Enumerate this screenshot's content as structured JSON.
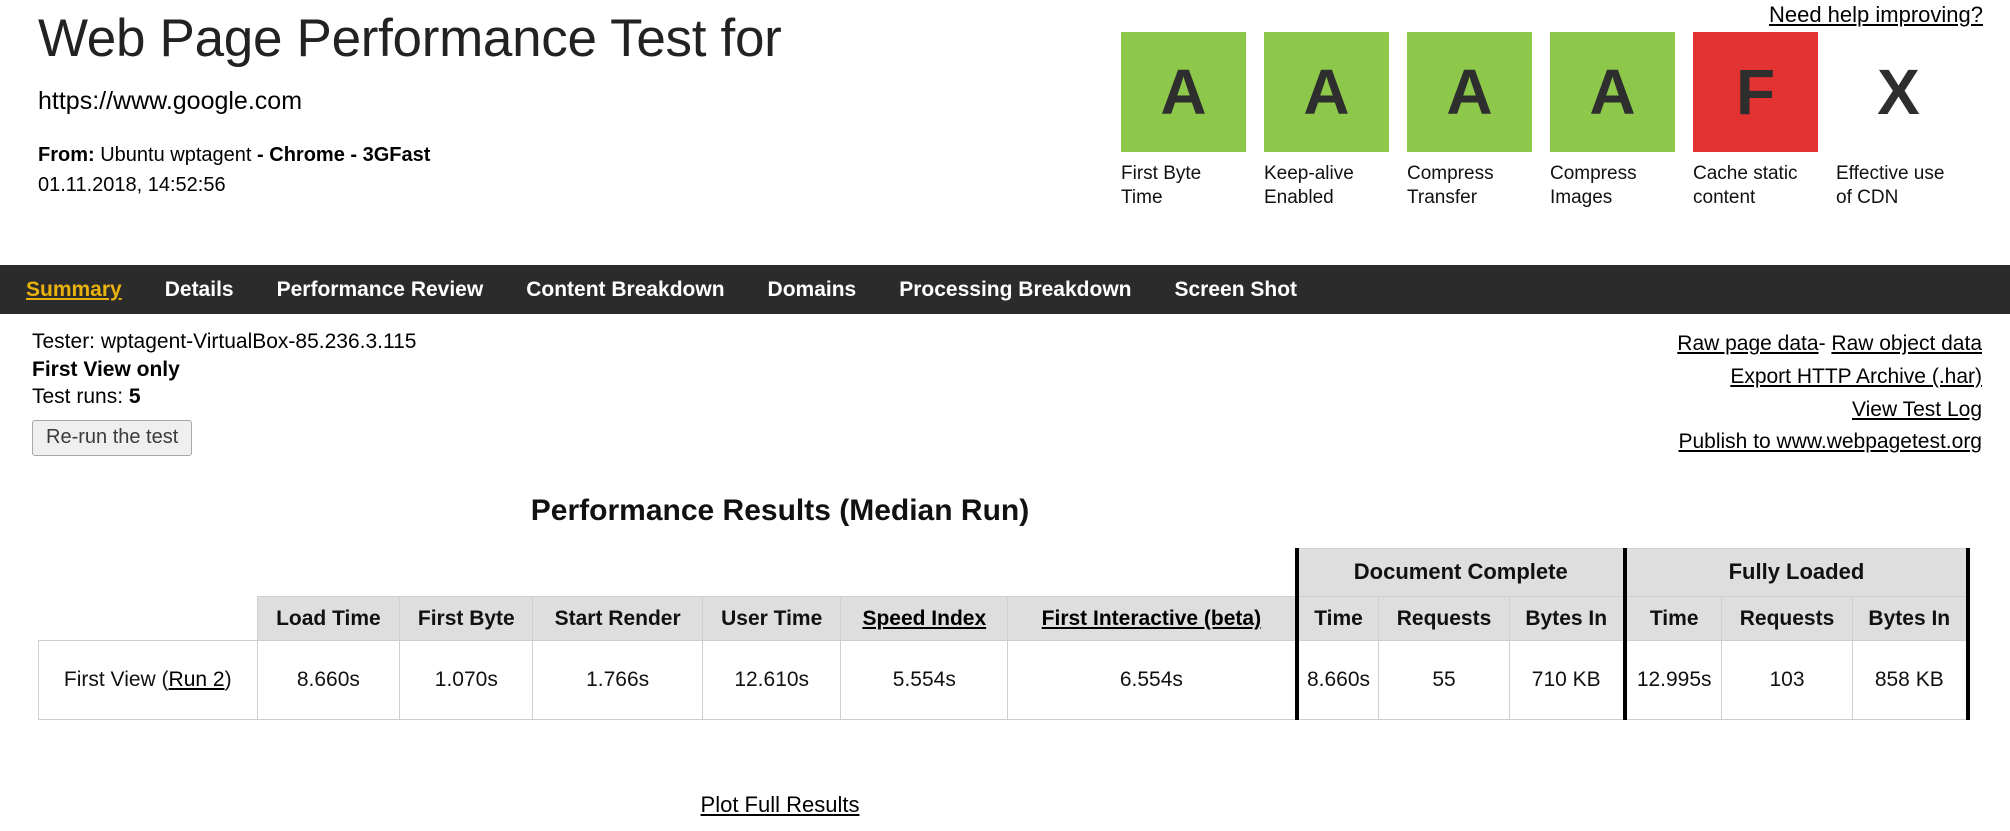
{
  "header": {
    "title": "Web Page Performance Test for",
    "url": "https://www.google.com",
    "from_label": "From:",
    "from_agent": "Ubuntu wptagent",
    "from_browser": "- Chrome - 3GFast",
    "date": "01.11.2018, 14:52:56",
    "need_help": "Need help improving?"
  },
  "grades": [
    {
      "letter": "A",
      "label": "First Byte Time",
      "color": "#8dc84a"
    },
    {
      "letter": "A",
      "label": "Keep-alive Enabled",
      "color": "#8dc84a"
    },
    {
      "letter": "A",
      "label": "Compress Transfer",
      "color": "#8dc84a"
    },
    {
      "letter": "A",
      "label": "Compress Images",
      "color": "#8dc84a"
    },
    {
      "letter": "F",
      "label": "Cache static content",
      "color": "#e33232"
    },
    {
      "letter": "X",
      "label": "Effective use of CDN",
      "color": "#ffffff"
    }
  ],
  "nav": {
    "items": [
      {
        "label": "Summary",
        "active": true
      },
      {
        "label": "Details",
        "active": false
      },
      {
        "label": "Performance Review",
        "active": false
      },
      {
        "label": "Content Breakdown",
        "active": false
      },
      {
        "label": "Domains",
        "active": false
      },
      {
        "label": "Processing Breakdown",
        "active": false
      },
      {
        "label": "Screen Shot",
        "active": false
      }
    ],
    "active_color": "#e9b20d",
    "background": "#2b2b2b"
  },
  "info": {
    "tester_label": "Tester:",
    "tester_value": "wptagent-VirtualBox-85.236.3.115",
    "view_mode": "First View only",
    "test_runs_label": "Test runs:",
    "test_runs_value": "5",
    "rerun_button": "Re-run the test",
    "links": {
      "raw_page_data": "Raw page data",
      "raw_separator": "-",
      "raw_object_data": "Raw object data",
      "export_har": "Export HTTP Archive (.har)",
      "view_test_log": "View Test Log",
      "publish": "Publish to www.webpagetest.org"
    }
  },
  "results": {
    "title": "Performance Results (Median Run)",
    "group_headers": {
      "document_complete": "Document Complete",
      "fully_loaded": "Fully Loaded"
    },
    "columns": [
      {
        "label": "Load Time",
        "link": false
      },
      {
        "label": "First Byte",
        "link": false
      },
      {
        "label": "Start Render",
        "link": false
      },
      {
        "label": "User Time",
        "link": false
      },
      {
        "label": "Speed Index",
        "link": true
      },
      {
        "label": "First Interactive (beta)",
        "link": true
      },
      {
        "label": "Time",
        "link": false
      },
      {
        "label": "Requests",
        "link": false
      },
      {
        "label": "Bytes In",
        "link": false
      },
      {
        "label": "Time",
        "link": false
      },
      {
        "label": "Requests",
        "link": false
      },
      {
        "label": "Bytes In",
        "link": false
      }
    ],
    "rows": [
      {
        "label_prefix": "First View (",
        "label_link": "Run 2",
        "label_suffix": ")",
        "values": [
          "8.660s",
          "1.070s",
          "1.766s",
          "12.610s",
          "5.554s",
          "6.554s",
          "8.660s",
          "55",
          "710 KB",
          "12.995s",
          "103",
          "858 KB"
        ]
      }
    ],
    "plot_link": "Plot Full Results"
  }
}
